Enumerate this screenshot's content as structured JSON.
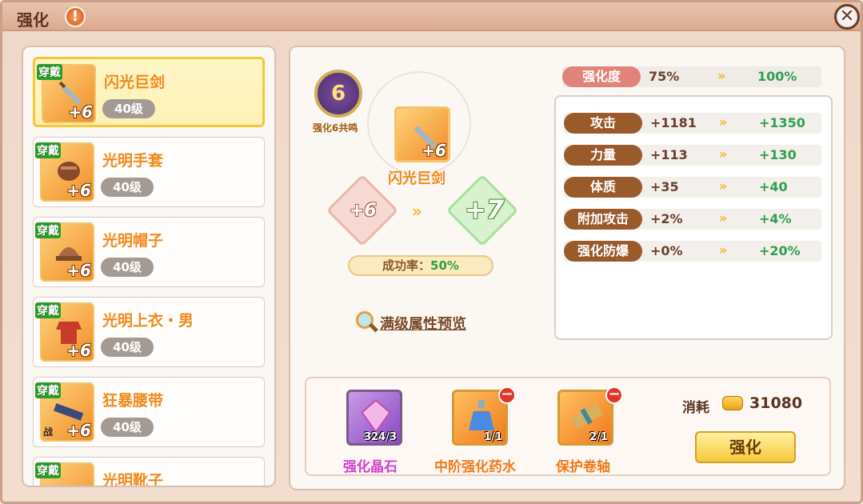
{
  "window": {
    "title": "强化",
    "info_symbol": "!",
    "close_symbol": "✕"
  },
  "item_list": [
    {
      "tag": "穿戴",
      "name": "闪光巨剑",
      "level": "40级",
      "plus": "+6",
      "selected": true,
      "icon": "sword-icon"
    },
    {
      "tag": "穿戴",
      "name": "光明手套",
      "level": "40级",
      "plus": "+6",
      "selected": false,
      "icon": "glove-icon"
    },
    {
      "tag": "穿戴",
      "name": "光明帽子",
      "level": "40级",
      "plus": "+6",
      "selected": false,
      "icon": "hat-icon"
    },
    {
      "tag": "穿戴",
      "name": "光明上衣・男",
      "level": "40级",
      "plus": "+6",
      "selected": false,
      "icon": "armor-icon"
    },
    {
      "tag": "穿戴",
      "name": "狂暴腰带",
      "level": "40级",
      "plus": "+6",
      "selected": false,
      "icon": "belt-icon",
      "extra": "战"
    },
    {
      "tag": "穿戴",
      "name": "光明靴子",
      "level": "",
      "plus": "",
      "selected": false,
      "icon": "boots-icon"
    }
  ],
  "enhance": {
    "medal_value": "6",
    "medal_label": "强化6共鸣",
    "item_name": "闪光巨剑",
    "item_plus": "+6",
    "from_level": "+6",
    "to_level": "+7",
    "arrows": "»",
    "success_label": "成功率：",
    "success_value": "50%",
    "preview_label": "满级属性预览"
  },
  "degree": {
    "label": "强化度",
    "current": "75%",
    "next": "100%"
  },
  "stats": [
    {
      "label": "攻击",
      "current": "+1181",
      "next": "+1350"
    },
    {
      "label": "力量",
      "current": "+113",
      "next": "+130"
    },
    {
      "label": "体质",
      "current": "+35",
      "next": "+40"
    },
    {
      "label": "附加攻击",
      "current": "+2%",
      "next": "+4%"
    },
    {
      "label": "强化防爆",
      "current": "+0%",
      "next": "+20%"
    }
  ],
  "materials": [
    {
      "name": "强化晶石",
      "count": "324/3",
      "icon": "crystal-icon",
      "color": "#d23fd0"
    },
    {
      "name": "中阶强化药水",
      "count": "1/1",
      "icon": "potion-icon",
      "color": "#f07a1c"
    },
    {
      "name": "保护卷轴",
      "count": "2/1",
      "icon": "scroll-icon",
      "color": "#f07a1c"
    }
  ],
  "cost": {
    "label": "消耗",
    "value": "31080"
  },
  "enhance_button": "强化",
  "colors": {
    "accent_orange": "#f08a1c",
    "green": "#2fa050",
    "brown": "#9a5a2a"
  }
}
